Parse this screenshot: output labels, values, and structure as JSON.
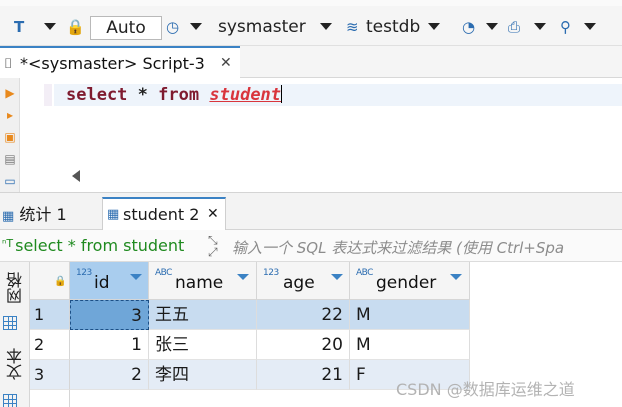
{
  "toolbar": {
    "commit_mode": "Auto",
    "datasource": "sysmaster",
    "database": "testdb"
  },
  "editor": {
    "tab_label": "*<sysmaster> Script-3",
    "code_select": "select",
    "code_star": "*",
    "code_from": "from",
    "code_table": "student"
  },
  "results": {
    "tabs": [
      {
        "label": "统计 1"
      },
      {
        "label": "student 2"
      }
    ],
    "filter_query": "select * from student",
    "filter_placeholder": "输入一个 SQL 表达式来过滤结果 (使用 Ctrl+Spa",
    "side_labels": [
      "网格",
      "文本"
    ],
    "columns": [
      {
        "name": "id",
        "type_badge": "123"
      },
      {
        "name": "name",
        "type_badge": "ABC"
      },
      {
        "name": "age",
        "type_badge": "123"
      },
      {
        "name": "gender",
        "type_badge": "ABC"
      }
    ],
    "rows": [
      {
        "rownum": "1",
        "id": "3",
        "name": "王五",
        "age": "22",
        "gender": "M"
      },
      {
        "rownum": "2",
        "id": "1",
        "name": "张三",
        "age": "20",
        "gender": "M"
      },
      {
        "rownum": "3",
        "id": "2",
        "name": "李四",
        "age": "21",
        "gender": "F"
      }
    ]
  },
  "watermark": "CSDN @数据库运维之道",
  "colors": {
    "accent": "#3b82c4",
    "keyword": "#7f1b2f",
    "table_name": "#d9353d",
    "selected_row": "#c8dcf0",
    "selected_cell": "#6fa6d8",
    "filter_text": "#1f8a1f"
  }
}
